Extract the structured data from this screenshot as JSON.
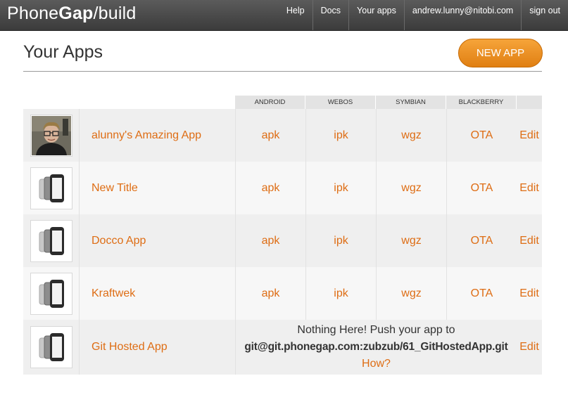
{
  "header": {
    "logo": {
      "part1": "Phone",
      "part2": "Gap",
      "part3": "/build"
    },
    "nav": [
      "Help",
      "Docs",
      "Your apps",
      "andrew.lunny@nitobi.com",
      "sign out"
    ]
  },
  "page": {
    "title": "Your Apps",
    "new_app_label": "NEW APP"
  },
  "table": {
    "columns": [
      "ANDROID",
      "WEBOS",
      "SYMBIAN",
      "BLACKBERRY"
    ],
    "apps": [
      {
        "name": "alunny's Amazing App",
        "icon": "user-photo",
        "android": "apk",
        "webos": "ipk",
        "symbian": "wgz",
        "blackberry": "OTA",
        "edit": "Edit"
      },
      {
        "name": "New Title",
        "icon": "default-phone-icon",
        "android": "apk",
        "webos": "ipk",
        "symbian": "wgz",
        "blackberry": "OTA",
        "edit": "Edit"
      },
      {
        "name": "Docco App",
        "icon": "default-phone-icon",
        "android": "apk",
        "webos": "ipk",
        "symbian": "wgz",
        "blackberry": "OTA",
        "edit": "Edit"
      },
      {
        "name": "Kraftwek",
        "icon": "default-phone-icon",
        "android": "apk",
        "webos": "ipk",
        "symbian": "wgz",
        "blackberry": "OTA",
        "edit": "Edit"
      },
      {
        "name": "Git Hosted App",
        "icon": "default-phone-icon",
        "message_line1": "Nothing Here! Push your app to",
        "message_line2": "git@git.phonegap.com:zubzub/61_GitHostedApp.git",
        "message_link": "How?",
        "edit": "Edit"
      }
    ]
  },
  "colors": {
    "accent": "#de6d14",
    "topbar": "#4a4a4a",
    "button": "#e98a1c"
  }
}
